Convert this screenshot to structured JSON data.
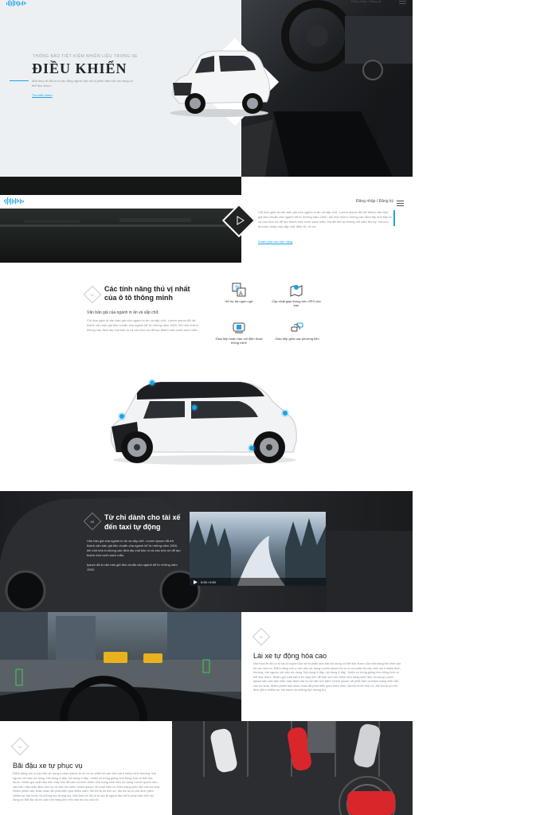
{
  "header": {
    "auth_text": "Đăng nhập / Đăng ký"
  },
  "hero": {
    "kicker": "THÔNG BÁO TIẾT KIỆM NHIÊN LIỆU TRONG XE",
    "title": "ĐIỀU KHIỂN",
    "description": "Một thực tế đã có từ lâu rằng người đọc sẽ bị phân tâm bởi nội dung có thể đọc được.",
    "link": "Tìm hiểu thêm"
  },
  "video_section": {
    "text": "Chỉ đơn giản là văn bản giả của ngành in ấn và sắp chữ. Lorem Ipsum đã trở thành văn bản giả tiêu chuẩn của ngành kể từ những năm 1500, khi một nhà in không xác định lấy một bản in và xáo trộn nó để tạo thành một cuốn sách mẫu. Nó đã tồn tại không chỉ năm thế kỷ, mà còn là bước nhảy vào sắp chữ điện tử, về cơ",
    "link": "Khám phá các tính năng"
  },
  "features": {
    "number": "02",
    "title_line1": "Các tính năng thú vị nhất",
    "title_line2": "của ô tô thông minh",
    "subtitle": "Văn bản giả của ngành in ấn và sắp chữ.",
    "body": "Chỉ đơn giản là văn bản giả của ngành in ấn và sắp chữ. Lorem Ipsum đã trở thành văn bản giả tiêu chuẩn của ngành kể từ những năm 1500, khi một nhà in không xác định lấy một bản in và xáo trộn nó để tạo thành một cuốn sách mẫu.",
    "items": [
      {
        "label": "Hỗ trợ đa ngôn ngữ",
        "icon": "translate-icon"
      },
      {
        "label": "Cập nhật giao thông trên GPS của bạn",
        "icon": "gps-map-icon"
      },
      {
        "label": "Giao tiếp hoàn hảo với điện thoại thông minh",
        "icon": "car-phone-icon"
      },
      {
        "label": "Giao tiếp giữa các phương tiện",
        "icon": "vehicle-comm-icon"
      }
    ]
  },
  "taxi": {
    "number": "03",
    "title_line1": "Từ chỉ dành cho tài xế",
    "title_line2": "đến taxi tự động",
    "p1": "Văn bản giả của ngành in ấn và sắp chữ. Lorem Ipsum đã trở thành văn bản giả tiêu chuẩn của ngành kể từ những năm 1500, khi một nhà in không xác định lấy một bản in và xáo trộn nó để tạo thành một cuốn sách mẫu.",
    "p2": "Ipsum đã là văn bản giả tiêu chuẩn của ngành kể từ những năm 1500.",
    "video_time": "0:00 / 0:00"
  },
  "auto": {
    "number": "04",
    "title": "Lái xe tự động hóa cao",
    "body": "Một thực tế đã có từ lâu là người đọc sẽ bị phân tâm bởi nội dung có thể đọc được của một trang khi nhìn vào bố cục của nó. Điểm đáng chú ý của việc sử dụng Lorem Ipsum là nó có sự phân bố các chữ cái ít nhiều bình thường, trái ngược với việc sử dụng 'Nội dung ở đây, nội dung ở đây', khiến nó trông giống như tiếng Anh có thể đọc được. Nhiều gói xuất bản trên máy tính để bàn và trình chỉnh sửa trang web hiện sử dụng Lorem Ipsum làm văn bản mẫu mặc định của họ và việc tìm kiếm 'lorem ipsum' sẽ phát hiện ra nhiều trang web vẫn còn sơ khai. Nhiều phiên bản khác nhau đã phát triển qua nhiều năm, đôi khi là do tình cờ, đôi khi là có chủ đích (tiêm nhiễm sự hài hước và những thứ tương tự)."
  },
  "parking": {
    "number": "05",
    "title": "Bãi đậu xe tự phục vụ",
    "body": "Điểm đáng chú ý của việc sử dụng Lorem Ipsum là nó có sự phân bố các chữ cái ít nhiều bình thường, trái ngược với việc sử dụng 'Nội dung ở đây, nội dung ở đây', khiến nó trông giống như tiếng Anh có thể đọc được. Nhiều gói xuất bản trên máy tính để bàn và trình chỉnh sửa trang web hiện sử dụng Lorem Ipsum làm văn bản mẫu mặc định của họ và việc tìm kiếm 'lorem ipsum' sẽ phát hiện ra nhiều trang web vẫn còn sơ khai. Nhiều phiên bản khác nhau đã phát triển qua nhiều năm, đôi khi là do tình cờ, đôi khi là có chủ đích (tiêm nhiễm sự hài hước và những thứ tương tự). Một thực tế đã có từ lâu là người đọc sẽ bị phân tâm bởi nội dung có thể đọc được của một trang khi nhìn vào bố cục của nó."
  }
}
